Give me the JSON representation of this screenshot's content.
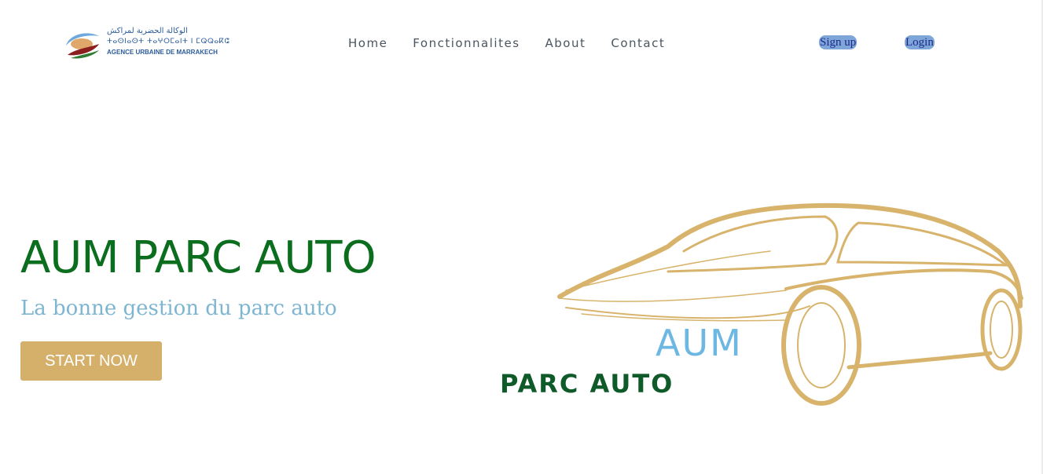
{
  "header": {
    "logo": {
      "arabic": "الوكالة الحضرية لمراكش",
      "tifinagh": "ⵜⴰⵙⵏⴰⵙⵜ ⵜⴰⵖⵔⵎⴰⵏⵜ ⵏ ⵎⵕⵕⴰⴽⵛ",
      "french": "AGENCE URBAINE DE MARRAKECH"
    },
    "nav": [
      "Home",
      "Fonctionnalites",
      "About",
      "Contact"
    ],
    "signup_label": "Sign up",
    "login_label": "Login"
  },
  "hero": {
    "title": "AUM PARC AUTO",
    "subtitle": "La bonne gestion du parc auto",
    "cta_label": "START NOW",
    "art": {
      "aum": "AUM",
      "parc": "PARC AUTO"
    }
  },
  "colors": {
    "title_green": "#0b6e1e",
    "subtitle_blue": "#7eb5d1",
    "cta_gold": "#d4b06a",
    "auth_bg": "#7fa6d8",
    "car_line": "#d8b36c"
  }
}
